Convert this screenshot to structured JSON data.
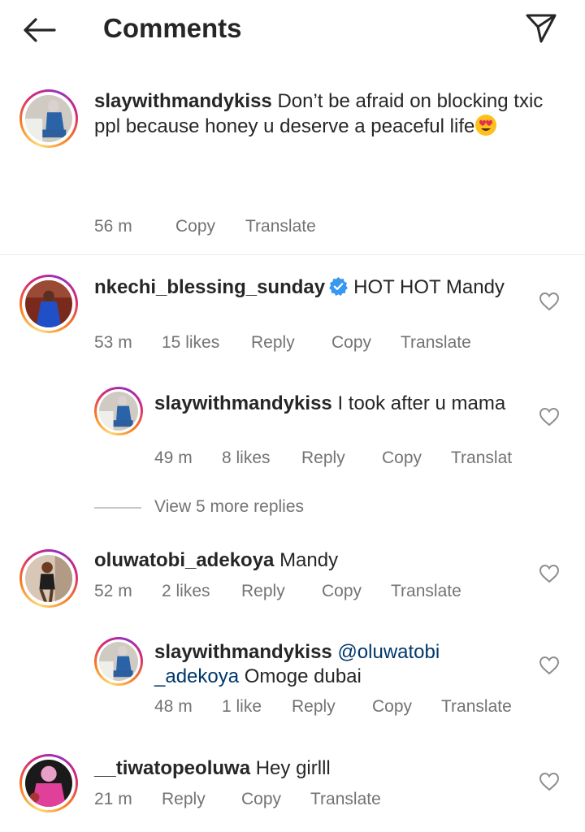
{
  "header": {
    "title": "Comments",
    "back_icon": "arrow-left-icon",
    "send_icon": "paper-plane-icon"
  },
  "caption": {
    "username": "slaywithmandykiss",
    "text": "Don’t be afraid on blocking txic ppl because honey u deserve a peaceful life",
    "time": "56 m",
    "copy": "Copy",
    "translate": "Translate"
  },
  "comments": [
    {
      "username": "nkechi_blessing_sunday",
      "verified": true,
      "text": "HOT HOT Mandy",
      "time": "53 m",
      "likes": "15 likes",
      "reply": "Reply",
      "copy": "Copy",
      "translate": "Translate"
    },
    {
      "username": "slaywithmandykiss",
      "text": "I took after u mama",
      "time": "49 m",
      "likes": "8 likes",
      "reply": "Reply",
      "copy": "Copy",
      "translate": "Translat"
    },
    {
      "username": "oluwatobi_adekoya",
      "text": "Mandy",
      "time": "52 m",
      "likes": "2 likes",
      "reply": "Reply",
      "copy": "Copy",
      "translate": "Translate"
    },
    {
      "username": "slaywithmandykiss",
      "mention_a": "@oluwatobi",
      "mention_b": "_adekoya",
      "text": "Omoge dubai",
      "time": "48 m",
      "likes": "1 like",
      "reply": "Reply",
      "copy": "Copy",
      "translate": "Translate"
    },
    {
      "username": "__tiwatopeoluwa",
      "text": "Hey girlll",
      "time": "21 m",
      "reply": "Reply",
      "copy": "Copy",
      "translate": "Translate"
    }
  ],
  "view_more": "View 5 more replies",
  "colors": {
    "text": "#262626",
    "meta": "#737373",
    "verified": "#3897f0",
    "mention": "#00376b"
  }
}
